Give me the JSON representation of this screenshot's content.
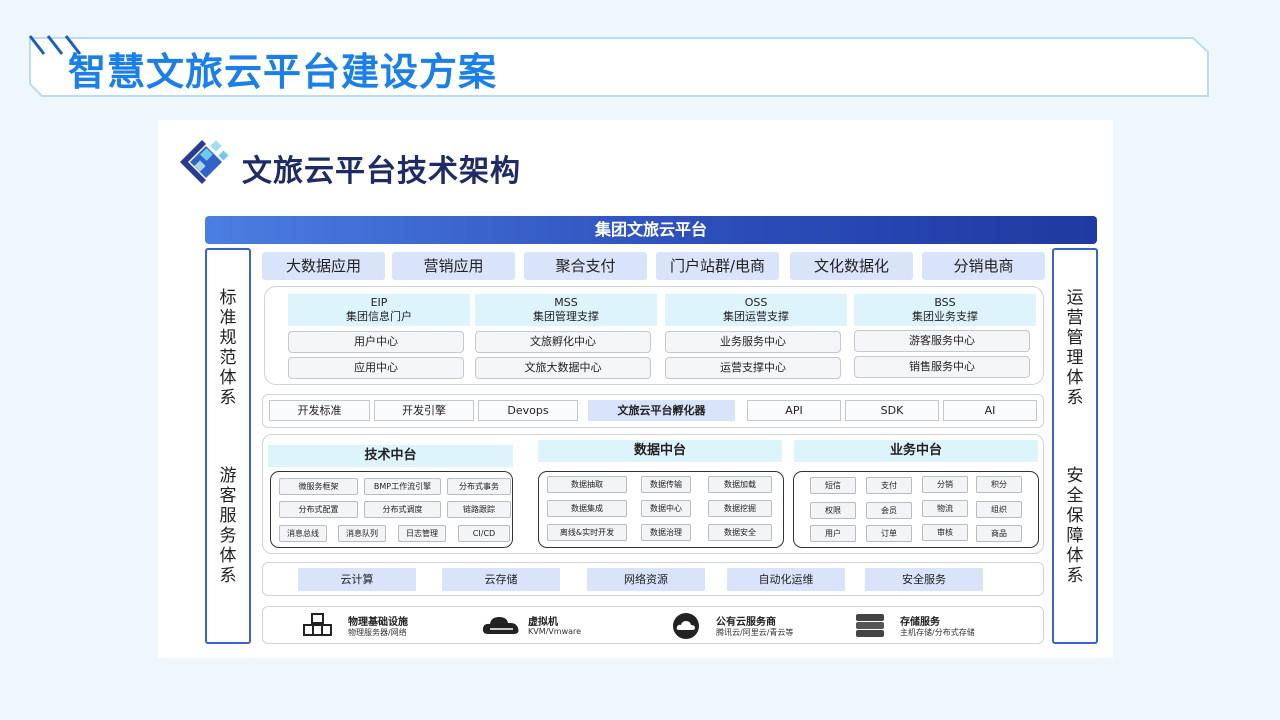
{
  "slide": {
    "title": "智慧文旅云平台建设方案"
  },
  "panel": {
    "title": "文旅云平台技术架构",
    "top_bar": "集团文旅云平台"
  },
  "side_left": {
    "upper": "标准规范体系",
    "lower": "游客服务体系"
  },
  "side_right": {
    "upper": "运营管理体系",
    "lower": "安全保障体系"
  },
  "apps": [
    "大数据应用",
    "营销应用",
    "聚合支付",
    "门户站群/电商",
    "文化数据化",
    "分销电商"
  ],
  "systems": [
    {
      "code": "EIP",
      "name": "集团信息门户",
      "items": [
        "用户中心",
        "应用中心"
      ]
    },
    {
      "code": "MSS",
      "name": "集团管理支撑",
      "items": [
        "文旅孵化中心",
        "文旅大数据中心"
      ]
    },
    {
      "code": "OSS",
      "name": "集团运营支撑",
      "items": [
        "业务服务中心",
        "运营支撑中心"
      ]
    },
    {
      "code": "BSS",
      "name": "集团业务支撑",
      "items": [
        "游客服务中心",
        "销售服务中心"
      ]
    }
  ],
  "tools": [
    "开发标准",
    "开发引擎",
    "Devops",
    "文旅云平台孵化器",
    "API",
    "SDK",
    "AI"
  ],
  "middle_platforms": [
    {
      "title": "技术中台",
      "items": [
        "微服务框架",
        "BMP工作流引擎",
        "分布式事务",
        "分布式配置",
        "分布式调度",
        "链路跟踪",
        "消息总线",
        "消息队列",
        "日志管理",
        "CI/CD"
      ]
    },
    {
      "title": "数据中台",
      "items": [
        "数据抽取",
        "数据传输",
        "数据加载",
        "数据集成",
        "数据中心",
        "数据挖掘",
        "离线&实时开发",
        "数据治理",
        "数据安全"
      ]
    },
    {
      "title": "业务中台",
      "items": [
        "短信",
        "支付",
        "分销",
        "积分",
        "权限",
        "会员",
        "物流",
        "组织",
        "用户",
        "订单",
        "审核",
        "商品"
      ]
    }
  ],
  "infra": [
    "云计算",
    "云存储",
    "网络资源",
    "自动化运维",
    "安全服务"
  ],
  "resources": [
    {
      "name": "物理基础设施",
      "sub": "物理服务器/网络",
      "icon": "cubes-icon"
    },
    {
      "name": "虚拟机",
      "sub": "KVM/Vmware",
      "icon": "cloud-icon"
    },
    {
      "name": "公有云服务商",
      "sub": "腾讯云/阿里云/青云等",
      "icon": "cloud-circle-icon"
    },
    {
      "name": "存储服务",
      "sub": "主机存储/分布式存储",
      "icon": "database-icon"
    }
  ],
  "colors": {
    "title_blue": "#1a7fe8",
    "bar_blue": "#2d4fbc",
    "light_blue": "#d9e4fb",
    "cyan_tint": "#def4fd"
  }
}
